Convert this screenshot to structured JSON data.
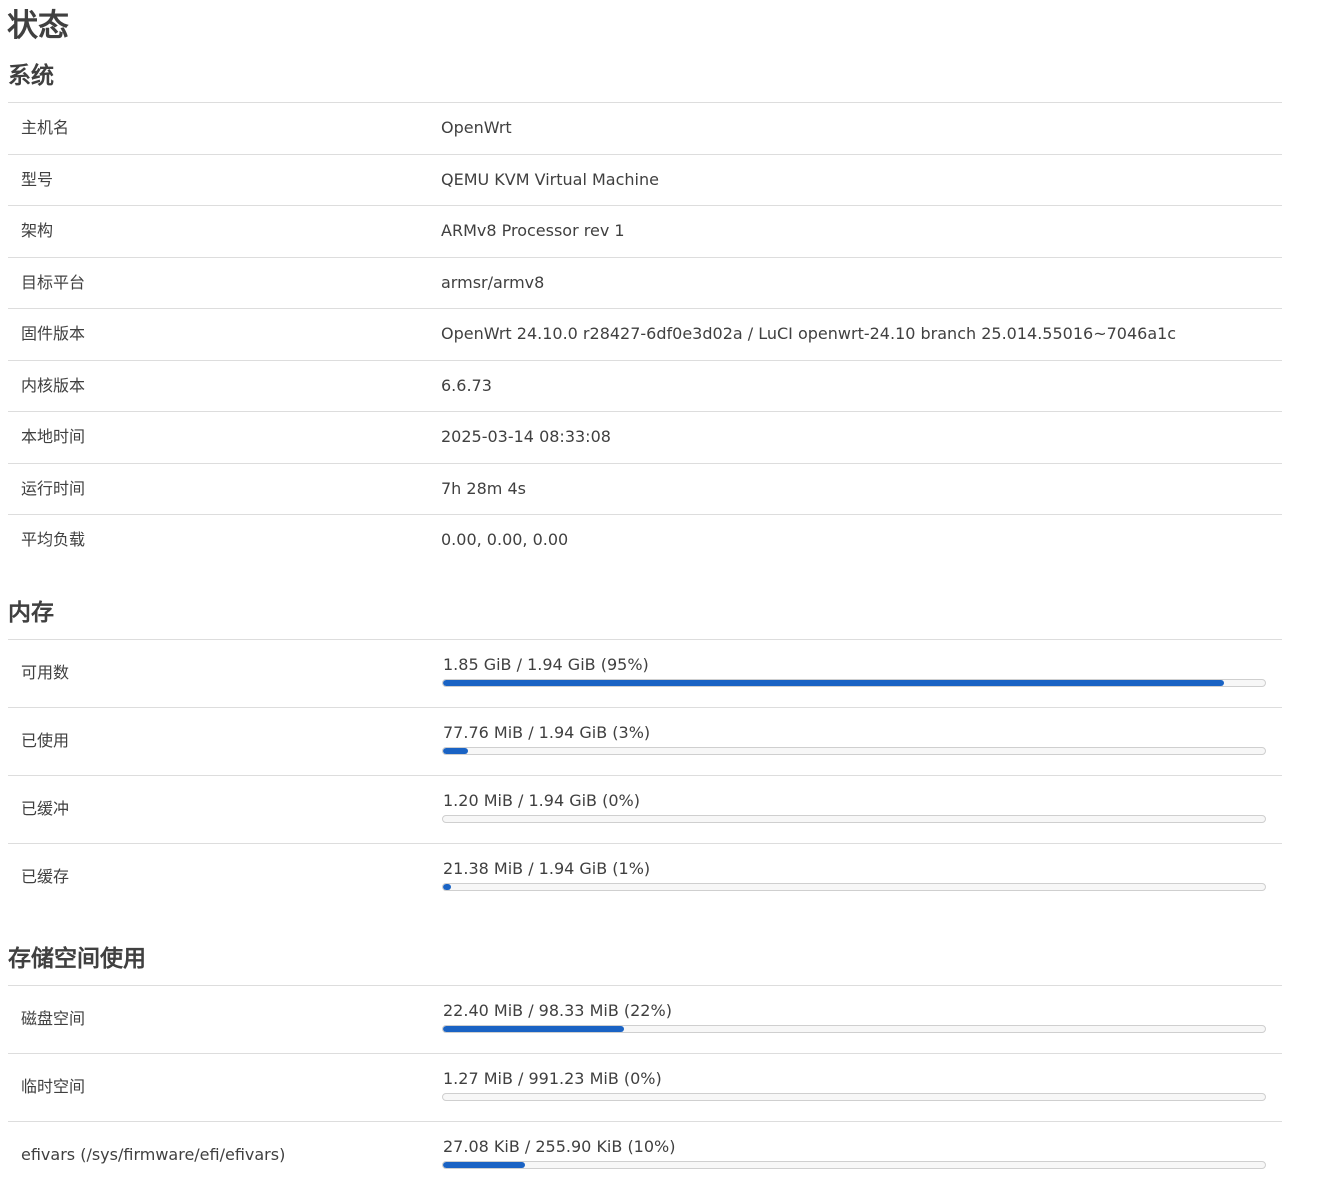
{
  "page_title": "状态",
  "system": {
    "title": "系统",
    "rows": [
      {
        "label": "主机名",
        "value": "OpenWrt"
      },
      {
        "label": "型号",
        "value": "QEMU KVM Virtual Machine"
      },
      {
        "label": "架构",
        "value": "ARMv8 Processor rev 1"
      },
      {
        "label": "目标平台",
        "value": "armsr/armv8"
      },
      {
        "label": "固件版本",
        "value": "OpenWrt 24.10.0 r28427-6df0e3d02a / LuCI openwrt-24.10 branch 25.014.55016~7046a1c"
      },
      {
        "label": "内核版本",
        "value": "6.6.73"
      },
      {
        "label": "本地时间",
        "value": "2025-03-14 08:33:08"
      },
      {
        "label": "运行时间",
        "value": "7h 28m 4s"
      },
      {
        "label": "平均负载",
        "value": "0.00, 0.00, 0.00"
      }
    ]
  },
  "memory": {
    "title": "内存",
    "rows": [
      {
        "label": "可用数",
        "text": "1.85 GiB / 1.94 GiB (95%)",
        "percent": 95
      },
      {
        "label": "已使用",
        "text": "77.76 MiB / 1.94 GiB (3%)",
        "percent": 3
      },
      {
        "label": "已缓冲",
        "text": "1.20 MiB / 1.94 GiB (0%)",
        "percent": 0
      },
      {
        "label": "已缓存",
        "text": "21.38 MiB / 1.94 GiB (1%)",
        "percent": 1
      }
    ]
  },
  "storage": {
    "title": "存储空间使用",
    "rows": [
      {
        "label": "磁盘空间",
        "text": "22.40 MiB / 98.33 MiB (22%)",
        "percent": 22
      },
      {
        "label": "临时空间",
        "text": "1.27 MiB / 991.23 MiB (0%)",
        "percent": 0
      },
      {
        "label": "efivars (/sys/firmware/efi/efivars)",
        "text": "27.08 KiB / 255.90 KiB (10%)",
        "percent": 10
      }
    ]
  },
  "colors": {
    "bar_fill": "#1a63c4",
    "text": "#404040",
    "divider": "#dddddd"
  }
}
